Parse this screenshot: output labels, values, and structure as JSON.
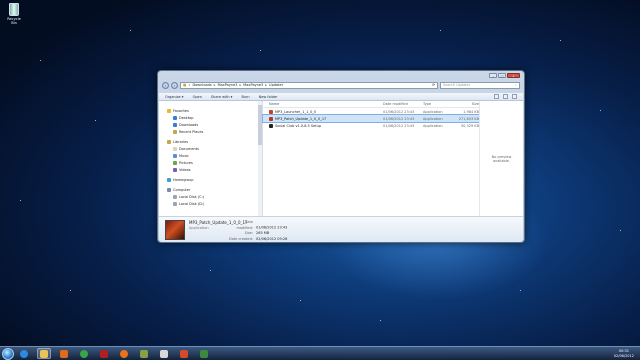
{
  "desktop": {
    "recycle_bin_label": "Recycle Bin"
  },
  "window": {
    "caption_buttons": {
      "minimize": "–",
      "maximize": "□",
      "close": "x"
    },
    "address_path": [
      "Downloads",
      "MaxPayne3",
      "MaxPayne3",
      "Updater"
    ],
    "search_placeholder": "Search Updater",
    "search_icon": "search-icon",
    "toolbar": {
      "organize": "Organize ▾",
      "open": "Open",
      "share_with": "Share with ▾",
      "burn": "Burn",
      "new_folder": "New folder"
    },
    "nav": {
      "favorites": "Favorites",
      "desktop": "Desktop",
      "downloads": "Downloads",
      "recent_places": "Recent Places",
      "libraries": "Libraries",
      "documents": "Documents",
      "music": "Music",
      "pictures": "Pictures",
      "videos": "Videos",
      "homegroup": "Homegroup",
      "computer": "Computer",
      "local_disk_c": "Local Disk (C:)",
      "local_disk_d": "Local Disk (D:)"
    },
    "columns": {
      "name": "Name",
      "date_modified": "Date modified",
      "type": "Type",
      "size": "Size"
    },
    "files": [
      {
        "name": "MP3_Launcher_1_1_0_0",
        "date": "01/06/2012 23:43",
        "type": "Application",
        "size": "1,984 KB",
        "color": "#c4402a"
      },
      {
        "name": "MP3_Patch_Update_1_0_0_17",
        "date": "01/06/2012 23:43",
        "type": "Application",
        "size": "271,603 KB",
        "color": "#b8351f"
      },
      {
        "name": "Social Club v1.0.8.5 Setup",
        "date": "01/06/2012 23:43",
        "type": "Application",
        "size": "50,329 KB",
        "color": "#222222"
      }
    ],
    "preview_text": "No preview available.",
    "details": {
      "name": "MP3_Patch_Update_1_0_0_17",
      "type": "Application",
      "date_modified_label": "Date modified:",
      "date_modified": "01/06/2012 23:43",
      "size_label": "Size:",
      "size": "265 MB",
      "date_created_label": "Date created:",
      "date_created": "02/06/2012 09:28"
    }
  },
  "taskbar": {
    "apps": [
      {
        "icon": "internet-explorer-icon",
        "color": "#2b8be0"
      },
      {
        "icon": "explorer-folder-icon",
        "color": "#e8c35a"
      },
      {
        "icon": "media-player-icon",
        "color": "#e06a1a"
      },
      {
        "icon": "chrome-icon",
        "color": "#3aa44a"
      },
      {
        "icon": "game-icon",
        "color": "#b02020"
      },
      {
        "icon": "firefox-icon",
        "color": "#e8731a"
      },
      {
        "icon": "archive-icon",
        "color": "#8aa040"
      },
      {
        "icon": "document-icon",
        "color": "#d8d8d8"
      },
      {
        "icon": "browser-icon",
        "color": "#d44a2a"
      },
      {
        "icon": "cmd-icon",
        "color": "#3d8a3d"
      }
    ],
    "clock_time": "00:31",
    "clock_date": "02/06/2012"
  }
}
